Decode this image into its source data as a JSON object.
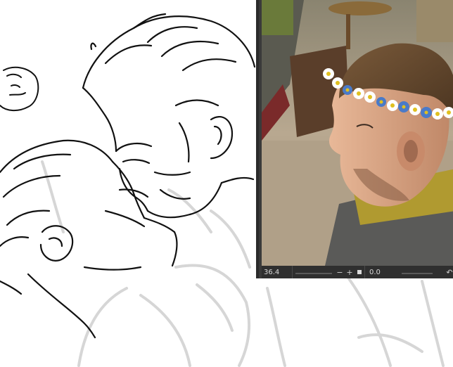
{
  "canvas": {
    "bg_color": "#ffffff",
    "line_color": "#111111",
    "sketch_color": "#d9d9d9"
  },
  "navigator": {
    "zoom_value": "36.4",
    "zoom_out_icon": "minus-icon",
    "zoom_in_icon": "plus-icon",
    "reset_icon": "square-icon",
    "angle_value": "0.0",
    "rotate_icon": "rotate-icon",
    "bar_color": "#2f2f2f"
  }
}
